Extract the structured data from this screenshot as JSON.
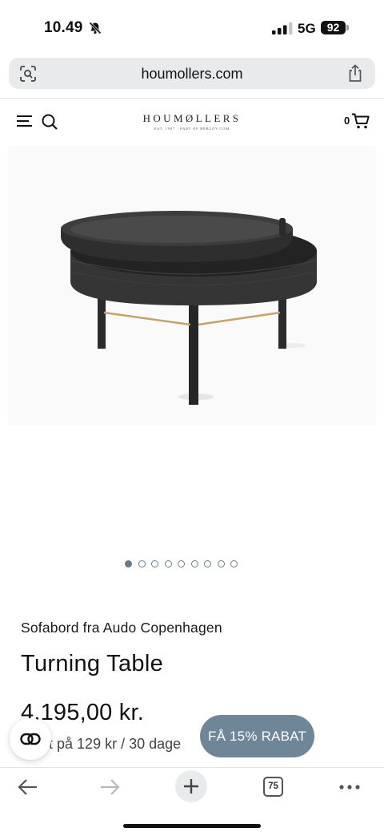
{
  "status_bar": {
    "time": "10.49",
    "network": "5G",
    "battery": "92"
  },
  "browser": {
    "url": "houmollers.com",
    "open_tabs": "75"
  },
  "site_header": {
    "logo_name": "HOUMØLLERS",
    "logo_tagline": "EST. 1907 · PART OF BEBLOV.COM",
    "cart_count": "0"
  },
  "product": {
    "brand_line": "Sofabord fra Audo Copenhagen",
    "title": "Turning Table",
    "price": "4.195,00 kr.",
    "installment": "Betal 31 gange fra 129 kr / 30 dage",
    "installment_visible": "...agt på 129 kr / 30 dage"
  },
  "carousel": {
    "total_images": 9,
    "active_index": 0
  },
  "promo": {
    "discount_label": "FÅ 15% RABAT"
  },
  "icons": {
    "status": [
      "bell-slash-icon",
      "signal-icon"
    ],
    "url_bar": [
      "lens-icon",
      "share-icon"
    ],
    "header": [
      "menu-icon",
      "search-icon",
      "cart-icon"
    ],
    "toolbar": [
      "back-arrow-icon",
      "forward-arrow-icon",
      "plus-icon",
      "tabs-icon",
      "more-icon"
    ]
  },
  "colors": {
    "accent": "#6e8698",
    "dot_active": "#6b7988",
    "url_bar_bg": "#e9eaec"
  }
}
